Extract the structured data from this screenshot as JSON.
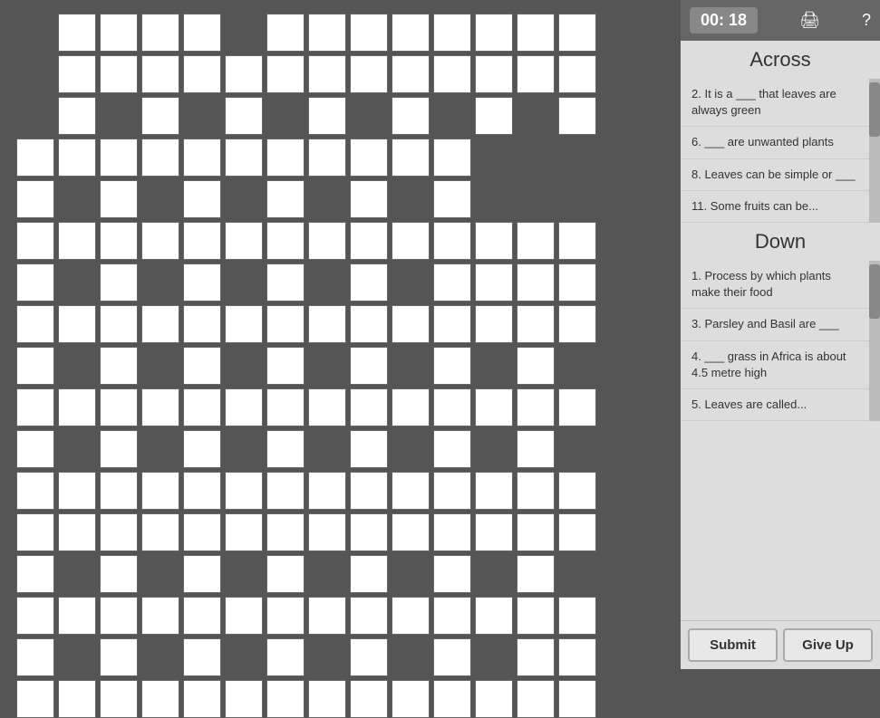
{
  "timer": {
    "display": "00: 18"
  },
  "icons": {
    "print": "🖨",
    "help": "?"
  },
  "across": {
    "title": "Across",
    "clues": [
      {
        "number": "2",
        "text": "2. It is a ___ that leaves are always green"
      },
      {
        "number": "6",
        "text": "6. ___ are unwanted plants"
      },
      {
        "number": "8",
        "text": "8. Leaves can be simple or ___"
      },
      {
        "number": "11",
        "text": "11. Some fruits can be..."
      }
    ]
  },
  "down": {
    "title": "Down",
    "clues": [
      {
        "number": "1",
        "text": "1. Process by which plants make their food"
      },
      {
        "number": "3",
        "text": "3. Parsley and Basil are ___"
      },
      {
        "number": "4",
        "text": "4. ___ grass in Africa is about 4.5 metre high"
      },
      {
        "number": "5",
        "text": "5. Leaves are called..."
      }
    ]
  },
  "buttons": {
    "submit": "Submit",
    "giveup": "Give Up"
  },
  "grid": {
    "cells": [
      [
        1,
        0
      ],
      [
        2,
        0
      ],
      [
        3,
        0
      ],
      [
        4,
        0
      ],
      [
        6,
        0
      ],
      [
        7,
        0
      ],
      [
        8,
        0
      ],
      [
        9,
        0
      ],
      [
        10,
        0
      ],
      [
        11,
        0
      ],
      [
        12,
        0
      ],
      [
        13,
        0
      ],
      [
        1,
        1
      ],
      [
        2,
        1
      ],
      [
        3,
        1
      ],
      [
        4,
        1
      ],
      [
        5,
        1
      ],
      [
        6,
        1
      ],
      [
        7,
        1
      ],
      [
        8,
        1
      ],
      [
        9,
        1
      ],
      [
        10,
        1
      ],
      [
        11,
        1
      ],
      [
        12,
        1
      ],
      [
        13,
        1
      ],
      [
        1,
        2
      ],
      [
        3,
        2
      ],
      [
        5,
        2
      ],
      [
        7,
        2
      ],
      [
        9,
        2
      ],
      [
        11,
        2
      ],
      [
        13,
        2
      ],
      [
        1,
        3
      ],
      [
        2,
        3
      ],
      [
        3,
        3
      ],
      [
        4,
        3
      ],
      [
        5,
        3
      ],
      [
        6,
        3
      ],
      [
        7,
        3
      ],
      [
        8,
        3
      ],
      [
        9,
        3
      ],
      [
        10,
        3
      ],
      [
        1,
        4
      ],
      [
        3,
        4
      ],
      [
        5,
        4
      ],
      [
        7,
        4
      ],
      [
        9,
        4
      ],
      [
        1,
        5
      ],
      [
        2,
        5
      ],
      [
        3,
        5
      ],
      [
        4,
        5
      ],
      [
        5,
        5
      ],
      [
        6,
        5
      ],
      [
        7,
        5
      ],
      [
        8,
        5
      ],
      [
        9,
        5
      ],
      [
        10,
        5
      ],
      [
        11,
        5
      ],
      [
        12,
        5
      ],
      [
        13,
        5
      ],
      [
        1,
        6
      ],
      [
        3,
        6
      ],
      [
        5,
        6
      ],
      [
        7,
        6
      ],
      [
        9,
        6
      ],
      [
        11,
        6
      ],
      [
        13,
        6
      ],
      [
        1,
        7
      ],
      [
        2,
        7
      ],
      [
        3,
        7
      ],
      [
        4,
        7
      ],
      [
        5,
        7
      ],
      [
        6,
        7
      ],
      [
        7,
        7
      ],
      [
        8,
        7
      ],
      [
        9,
        7
      ],
      [
        10,
        7
      ],
      [
        11,
        7
      ],
      [
        12,
        7
      ],
      [
        13,
        7
      ],
      [
        1,
        8
      ],
      [
        3,
        8
      ],
      [
        5,
        8
      ],
      [
        7,
        8
      ],
      [
        9,
        8
      ],
      [
        11,
        8
      ],
      [
        13,
        8
      ],
      [
        0,
        9
      ],
      [
        1,
        9
      ],
      [
        2,
        9
      ],
      [
        3,
        9
      ],
      [
        4,
        9
      ],
      [
        5,
        9
      ],
      [
        6,
        9
      ],
      [
        7,
        9
      ],
      [
        8,
        9
      ],
      [
        9,
        9
      ],
      [
        10,
        9
      ],
      [
        11,
        9
      ],
      [
        12,
        9
      ],
      [
        13,
        9
      ],
      [
        0,
        10
      ],
      [
        2,
        10
      ],
      [
        4,
        10
      ],
      [
        6,
        10
      ],
      [
        8,
        10
      ],
      [
        10,
        10
      ],
      [
        12,
        10
      ],
      [
        0,
        11
      ],
      [
        1,
        11
      ],
      [
        2,
        11
      ],
      [
        3,
        11
      ],
      [
        4,
        11
      ],
      [
        5,
        11
      ],
      [
        6,
        11
      ],
      [
        7,
        11
      ],
      [
        8,
        11
      ],
      [
        9,
        11
      ],
      [
        10,
        11
      ],
      [
        11,
        11
      ],
      [
        12,
        11
      ],
      [
        13,
        11
      ],
      [
        0,
        12
      ],
      [
        2,
        12
      ],
      [
        4,
        12
      ],
      [
        6,
        12
      ],
      [
        8,
        12
      ],
      [
        10,
        12
      ],
      [
        12,
        12
      ],
      [
        0,
        13
      ],
      [
        1,
        13
      ],
      [
        2,
        13
      ],
      [
        3,
        13
      ],
      [
        4,
        13
      ],
      [
        5,
        13
      ],
      [
        6,
        13
      ],
      [
        7,
        13
      ],
      [
        8,
        13
      ],
      [
        9,
        13
      ],
      [
        10,
        13
      ],
      [
        11,
        13
      ],
      [
        12,
        13
      ],
      [
        13,
        13
      ],
      [
        0,
        14
      ],
      [
        2,
        14
      ],
      [
        4,
        14
      ],
      [
        6,
        14
      ],
      [
        8,
        14
      ],
      [
        10,
        14
      ],
      [
        12,
        14
      ],
      [
        0,
        15
      ],
      [
        1,
        15
      ],
      [
        2,
        15
      ],
      [
        3,
        15
      ],
      [
        4,
        15
      ],
      [
        5,
        15
      ],
      [
        6,
        15
      ],
      [
        7,
        15
      ],
      [
        8,
        15
      ],
      [
        9,
        15
      ],
      [
        10,
        15
      ],
      [
        11,
        15
      ],
      [
        12,
        15
      ],
      [
        13,
        15
      ]
    ]
  }
}
